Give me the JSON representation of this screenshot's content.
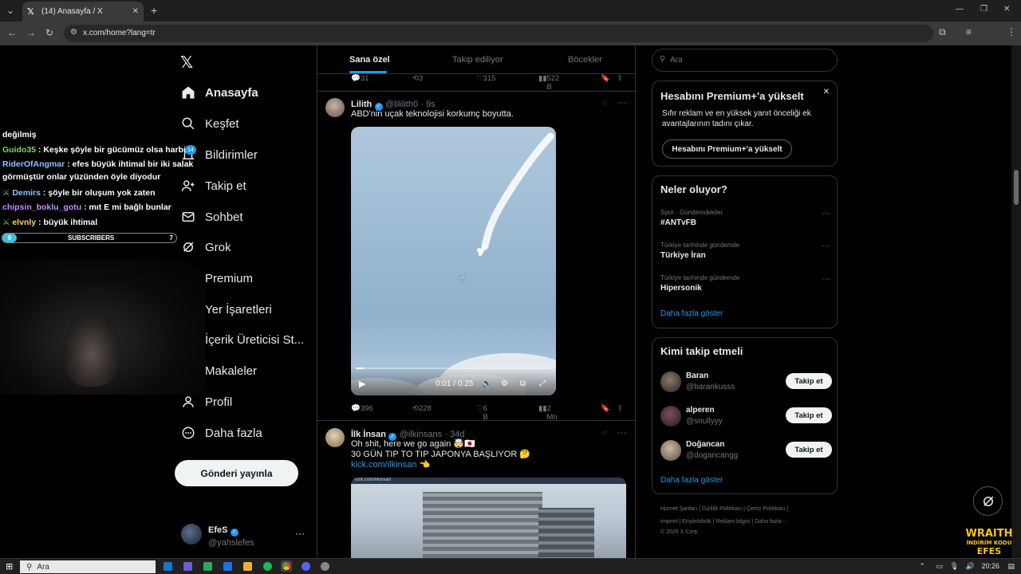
{
  "browser": {
    "tab_title": "(14) Anasayfa / X",
    "url": "x.com/home?lang=tr",
    "new_tab": "+",
    "window_buttons": [
      "—",
      "❐",
      "✕"
    ]
  },
  "nav": {
    "items": [
      {
        "label": "Anasayfa",
        "icon": "home-icon"
      },
      {
        "label": "Keşfet",
        "icon": "search-icon"
      },
      {
        "label": "Bildirimler",
        "icon": "bell-icon"
      },
      {
        "label": "Takip et",
        "icon": "follow-icon"
      },
      {
        "label": "Sohbet",
        "icon": "mail-icon"
      },
      {
        "label": "Grok",
        "icon": "grok-icon"
      },
      {
        "label": "Premium",
        "icon": "x-logo-icon"
      },
      {
        "label": "Yer İşaretleri",
        "icon": "bookmark-icon"
      },
      {
        "label": "İçerik Üreticisi St...",
        "icon": "lightning-icon"
      },
      {
        "label": "Makaleler",
        "icon": "article-icon"
      },
      {
        "label": "Profil",
        "icon": "user-icon"
      },
      {
        "label": "Daha fazla",
        "icon": "more-circle-icon"
      }
    ],
    "notification_badge": "14",
    "post_button": "Gönderi yayınla",
    "account": {
      "name": "EfeS",
      "handle": "@yahslefes",
      "more": "···"
    }
  },
  "chat": {
    "lines": [
      {
        "user": "",
        "msg": "değilmiş",
        "color": "#ffffff"
      },
      {
        "user": "Guido35",
        "msg": " : Keşke şöyle bir gücümüz olsa harbi",
        "color": "#7fd36a"
      },
      {
        "user": "RiderOfAngmar",
        "msg": " : efes büyük ihtimal bir iki salak",
        "color": "#8fc4ff"
      },
      {
        "user": "",
        "msg": "görmüştür onlar yüzünden öyle diyodur",
        "color": "#ffffff"
      },
      {
        "user": "Demirs",
        "msg": " : şöyle bir oluşum yok zaten",
        "color": "#8fc4ff"
      },
      {
        "user": "chipsin_boklu_gotu",
        "msg": " : mıt E mi bağlı bunlar",
        "color": "#c28dff"
      },
      {
        "user": "elvnly",
        "msg": " : büyük ihtimal",
        "color": "#ffd060"
      }
    ],
    "subscribers": {
      "label": "SUBSCRIBERS",
      "current": "0",
      "goal": "7"
    }
  },
  "timeline": {
    "tabs": [
      "Sana özel",
      "Takip ediliyor",
      "Böcekler"
    ],
    "prev_actions": {
      "replies": "31",
      "reposts": "3",
      "likes": "315",
      "views": "522 B"
    },
    "tweet1": {
      "name": "Lilith",
      "handle": "@lililith0",
      "time": "· 9s",
      "text": "ABD'nin uçak teknolojisi korkumç boyutta.",
      "video_time": "0:01 / 0:25",
      "video_progress": 0.04,
      "actions": {
        "replies": "396",
        "reposts": "228",
        "likes": "6 B",
        "views": "2 Mn"
      }
    },
    "tweet2": {
      "name": "İlk İnsan",
      "handle": "@ilkinsans",
      "time": "· 34d",
      "line1": "Oh shit, here we go again 🤯🇯🇵",
      "line2": "30 GÜN TIP TO TIP JAPONYA BAŞLIYOR 🤔",
      "link": "kick.com/ilkinsan 👈",
      "image_caption": "Kick.com/ilkinsan"
    }
  },
  "sidebar": {
    "search_placeholder": "Ara",
    "premium": {
      "title": "Hesabını Premium+'a yükselt",
      "body": "Sıfır reklam ve en yüksek yanıt önceliği ek avantajlarının tadını çıkar.",
      "button": "Hesabını Premium+'a yükselt",
      "close": "✕"
    },
    "trends": {
      "title": "Neler oluyor?",
      "items": [
        {
          "context": "Spor · Gündemdekiler",
          "name": "#ANTvFB"
        },
        {
          "context": "Türkiye tarihinde gündemde",
          "name": "Türkiye İran"
        },
        {
          "context": "Türkiye tarihinde gündemde",
          "name": "Hipersonik"
        }
      ],
      "more": "Daha fazla göster"
    },
    "who_to_follow": {
      "title": "Kimi takip etmeli",
      "items": [
        {
          "name": "Baran",
          "handle": "@barankusss",
          "button": "Takip et"
        },
        {
          "name": "alperen",
          "handle": "@snullyyy",
          "button": "Takip et"
        },
        {
          "name": "Doğancan",
          "handle": "@dogancangg",
          "button": "Takip et"
        }
      ],
      "more": "Daha fazla göster"
    },
    "footer": {
      "row1": "Hizmet Şartları  |  Gizlilik Politikası  |  Çerez Politikası  |",
      "row2": "Imprint  |  Erişilebilirlik  |  Reklam bilgisi  |  Daha fazla ···",
      "row3": "© 2026 X Corp."
    }
  },
  "overlay": {
    "wraith_line1": "WRAITH",
    "wraith_line2": "İNDİRİM KODU",
    "wraith_line3": "EFES"
  },
  "taskbar": {
    "search_placeholder": "Ara",
    "clock": "20:26"
  },
  "colors": {
    "accent": "#1d9bf0",
    "background": "#000000",
    "border": "#2f3336",
    "muted": "#71767b"
  }
}
